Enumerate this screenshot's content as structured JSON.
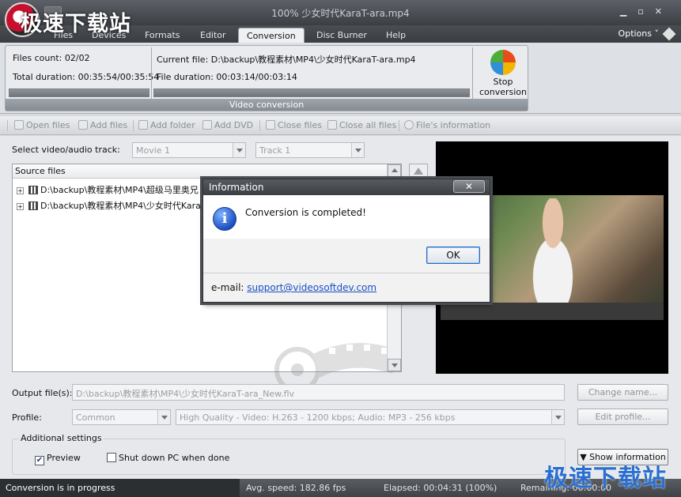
{
  "window": {
    "title": "100% 少女时代KaraT-ara.mp4",
    "watermark_top": "极速下载站"
  },
  "menu": {
    "tabs": [
      {
        "label": "Files"
      },
      {
        "label": "Devices"
      },
      {
        "label": "Formats"
      },
      {
        "label": "Editor"
      },
      {
        "label": "Conversion"
      },
      {
        "label": "Disc Burner"
      },
      {
        "label": "Help"
      }
    ],
    "active_tab": "Conversion",
    "options_label": "Options"
  },
  "ribbon": {
    "files_count": "Files count: 02/02",
    "total_duration": "Total duration: 00:35:54/00:35:54",
    "current_file": "Current file: D:\\backup\\教程素材\\MP4\\少女时代KaraT-ara.mp4",
    "file_duration": "File duration: 00:03:14/00:03:14",
    "group_label": "Video conversion",
    "stop_line1": "Stop",
    "stop_line2": "conversion",
    "total_progress": 1.0,
    "file_progress": 1.0
  },
  "toolbar": {
    "items": [
      {
        "label": "Open files"
      },
      {
        "label": "Add files"
      },
      {
        "label": "Add folder"
      },
      {
        "label": "Add DVD"
      },
      {
        "label": "Close files"
      },
      {
        "label": "Close all files"
      },
      {
        "label": "File's information"
      }
    ]
  },
  "main": {
    "track_label": "Select video/audio track:",
    "movie_combo": "Movie 1",
    "track_combo": "Track 1",
    "source_header": "Source files",
    "source_rows": [
      {
        "path": "D:\\backup\\教程素材\\MP4\\超级马里奥兄"
      },
      {
        "path": "D:\\backup\\教程素材\\MP4\\少女时代Kara"
      }
    ],
    "output_label": "Output file(s):",
    "output_value": "D:\\backup\\教程素材\\MP4\\少女时代KaraT-ara_New.flv",
    "change_name": "Change name...",
    "profile_label": "Profile:",
    "profile_value": "Common",
    "quality_value": "High Quality - Video: H.263 - 1200 kbps; Audio: MP3 - 256 kbps",
    "edit_profile": "Edit profile...",
    "additional_settings": "Additional settings",
    "preview_label": "Preview",
    "preview_checked": true,
    "shutdown_label": "Shut down PC when done",
    "shutdown_checked": false,
    "show_info": "▼ Show information"
  },
  "status": {
    "main": "Conversion is in progress",
    "speed": "Avg. speed: 182.86 fps",
    "elapsed": "Elapsed: 00:04:31 (100%)",
    "remaining": "Remaining: 00:00:00",
    "watermark": "极速下载站"
  },
  "dialog": {
    "title": "Information",
    "message": "Conversion is completed!",
    "ok_label": "OK",
    "email_label": "e-mail:",
    "email_link": "support@videosoftdev.com"
  }
}
